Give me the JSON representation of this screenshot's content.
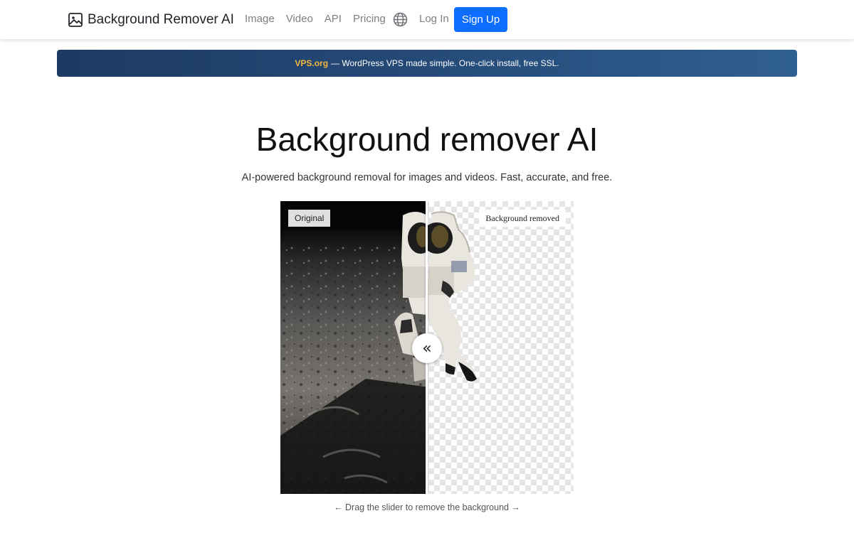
{
  "navbar": {
    "brand": "Background Remover AI",
    "links": [
      "Image",
      "Video",
      "API",
      "Pricing"
    ],
    "login": "Log In",
    "signup": "Sign Up"
  },
  "promo": {
    "brand": "VPS.org",
    "text": "— WordPress VPS made simple. One-click install, free SSL."
  },
  "hero": {
    "title": "Background remover AI",
    "subtitle": "AI-powered background removal for images and videos. Fast, accurate, and free."
  },
  "comparison": {
    "label_original": "Original",
    "label_removed": "Background removed",
    "handle_glyph": "«",
    "hint": "← Drag the slider to remove the background →"
  }
}
